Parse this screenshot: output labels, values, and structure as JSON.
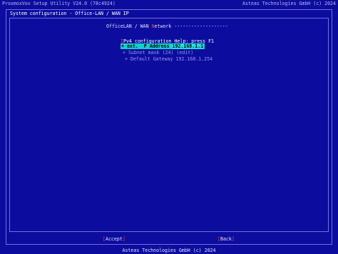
{
  "app": {
    "title": "ProxmoxVox Setup Utility V24.0 (78c4924)",
    "vendor": "Asteas Technologies GmbH (c) 2024"
  },
  "window": {
    "title": "System configuration - Office-LAN / WAN IP"
  },
  "section": {
    "title_hotkey": "O",
    "title_a": "fficeLAN / WAN ",
    "title_hl": "N",
    "title_b": "etwork -------------------"
  },
  "help": {
    "hotkey": "I",
    "text": "Pv4 configuration Help: press F1"
  },
  "items": [
    {
      "prefix": "+ ext.  P Address ",
      "value": "192.168.1.1"
    },
    {
      "text": "+ Subnet mask (24) (edit)"
    },
    {
      "text": "+ Default Gateway 192.168.1.254"
    }
  ],
  "buttons": {
    "accept_open": "[",
    "accept_label": "Accept",
    "accept_close": "]",
    "back_open": "[",
    "back_label": "Back",
    "back_close": "]"
  },
  "footer": {
    "text": "Asteas Technologies GmbH (c) 2024"
  }
}
